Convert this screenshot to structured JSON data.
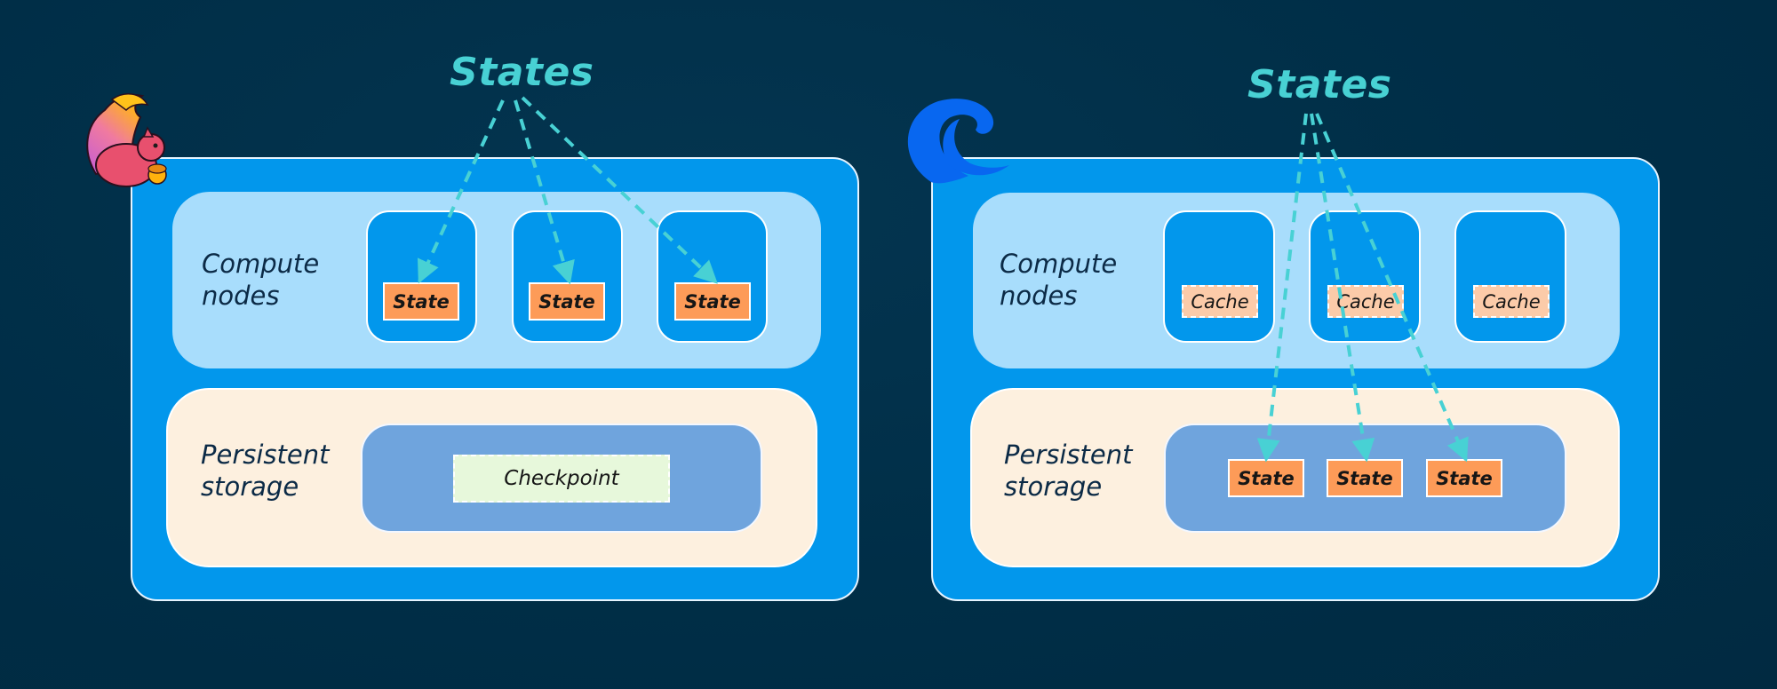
{
  "diagram": {
    "left_panel": {
      "logo": "squirrel-logo-icon",
      "title": "States",
      "compute_label_line1": "Compute",
      "compute_label_line2": "nodes",
      "compute_nodes": [
        {
          "item": "State"
        },
        {
          "item": "State"
        },
        {
          "item": "State"
        }
      ],
      "storage_label_line1": "Persistent",
      "storage_label_line2": "storage",
      "storage_items": [
        "Checkpoint"
      ],
      "arrows_target": "compute-node-states"
    },
    "right_panel": {
      "logo": "wave-logo-icon",
      "title": "States",
      "compute_label_line1": "Compute",
      "compute_label_line2": "nodes",
      "compute_nodes": [
        {
          "item": "Cache"
        },
        {
          "item": "Cache"
        },
        {
          "item": "Cache"
        }
      ],
      "storage_label_line1": "Persistent",
      "storage_label_line2": "storage",
      "storage_items": [
        "State",
        "State",
        "State"
      ],
      "arrows_target": "persistent-storage-states"
    },
    "colors": {
      "background": "#002e47",
      "outer_box": "#0297ec",
      "compute_area": "#a8ddfc",
      "storage_area": "#fdf0df",
      "storage_inner": "#6fa4dd",
      "state": "#fd9b58",
      "cache": "#fccba9",
      "checkpoint": "#e7f8db",
      "arrow": "#48d1d4"
    }
  }
}
